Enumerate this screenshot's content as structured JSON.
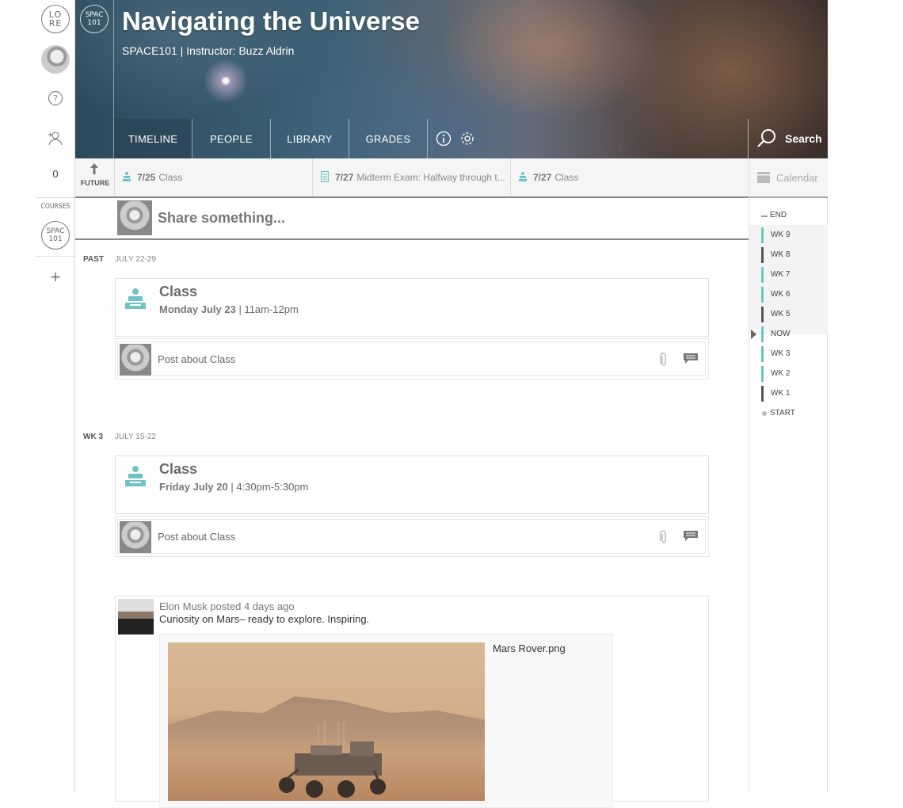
{
  "rail": {
    "logo_line1": "LO",
    "logo_line2": "RE",
    "notifications_count": "0",
    "courses_label": "COURSES",
    "course_line1": "SPAC",
    "course_line2": "101",
    "add_label": "+"
  },
  "header": {
    "logo_line1": "SPAC",
    "logo_line2": "101",
    "title": "Navigating the Universe",
    "subtitle": "SPACE101 | Instructor: Buzz Aldrin",
    "tabs": [
      "TIMELINE",
      "PEOPLE",
      "LIBRARY",
      "GRADES"
    ],
    "active_tab": "TIMELINE",
    "search_label": "Search"
  },
  "timeline_bar": {
    "future_label": "FUTURE",
    "items": [
      {
        "date": "7/25",
        "text": "Class",
        "icon": "class-icon"
      },
      {
        "date": "7/27",
        "text": "Midterm Exam: Halfway through t...",
        "icon": "exam-icon"
      },
      {
        "date": "7/27",
        "text": "Class",
        "icon": "class-icon"
      }
    ]
  },
  "calendar": {
    "label": "Calendar",
    "weeks": [
      "END",
      "WK 9",
      "WK 8",
      "WK 7",
      "WK 6",
      "WK 5",
      "NOW",
      "WK 3",
      "WK 2",
      "WK 1",
      "START"
    ]
  },
  "share": {
    "placeholder": "Share something..."
  },
  "sections": [
    {
      "label": "PAST",
      "date_range": "JULY 22-29",
      "event": {
        "title": "Class",
        "day": "Monday July 23",
        "time": "| 11am-12pm"
      },
      "post_placeholder": "Post about Class"
    },
    {
      "label": "WK 3",
      "date_range": "JULY 15-22",
      "event": {
        "title": "Class",
        "day": "Friday July 20",
        "time": "| 4:30pm-5:30pm"
      },
      "post_placeholder": "Post about Class"
    }
  ],
  "feed_post": {
    "meta": "Elon Musk posted 4 days ago",
    "body": "Curiosity on Mars– ready to explore. Inspiring.",
    "attachment_name": "Mars Rover.png"
  },
  "colors": {
    "accent": "#6fc3c3",
    "brand_dark": "#555555"
  }
}
